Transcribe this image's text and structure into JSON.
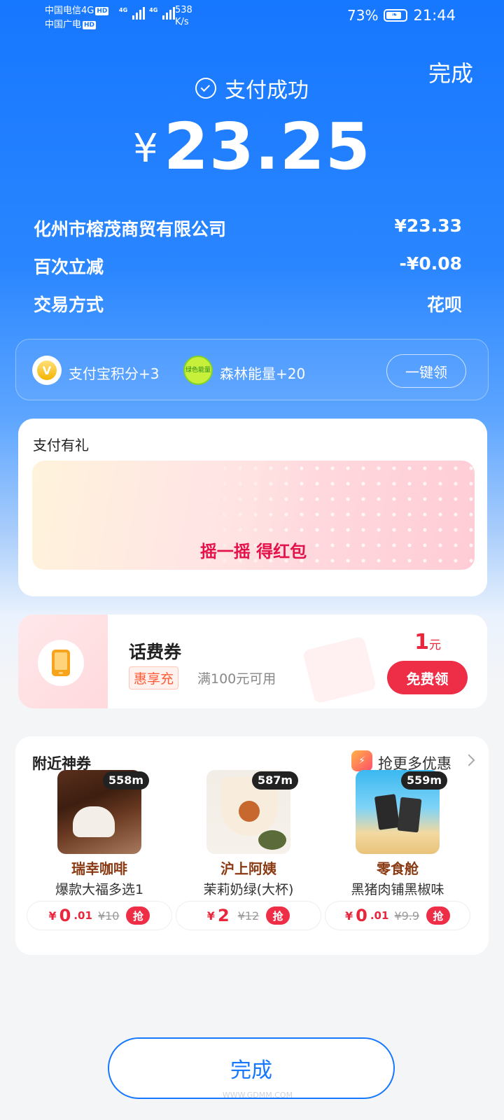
{
  "status_bar": {
    "carrier1": "中国电信4G",
    "carrier2": "中国广电",
    "hd": "HD",
    "net_small": "4G",
    "speed_value": "538",
    "speed_unit": "K/s",
    "battery": "73%",
    "time": "21:44"
  },
  "header": {
    "done_label": "完成",
    "success_label": "支付成功",
    "currency": "¥",
    "amount": "23.25"
  },
  "details": [
    {
      "label": "化州市榕茂商贸有限公司",
      "value": "¥23.33"
    },
    {
      "label": "百次立减",
      "value": "-¥0.08"
    },
    {
      "label": "交易方式",
      "value": "花呗"
    }
  ],
  "rewards": {
    "points": "支付宝积分+3",
    "points_icon_char": "V",
    "forest_icon_text": "绿色能量",
    "forest": "森林能量+20",
    "claim_label": "一键领"
  },
  "gift": {
    "title": "支付有礼",
    "banner_text": "摇一摇 得红包"
  },
  "voucher": {
    "title": "话费券",
    "tag": "惠享充",
    "condition": "满100元可用",
    "amount": "1",
    "unit": "元",
    "button": "免费领"
  },
  "nearby": {
    "title": "附近神券",
    "more_label": "抢更多优惠",
    "items": [
      {
        "distance": "558m",
        "shop": "瑞幸咖啡",
        "item": "爆款大福多选1",
        "price_int": "0",
        "price_dec": ".01",
        "orig": "¥10",
        "grab": "抢"
      },
      {
        "distance": "587m",
        "shop": "沪上阿姨",
        "item": "茉莉奶绿(大杯)",
        "price_int": "2",
        "price_dec": "",
        "orig": "¥12",
        "grab": "抢"
      },
      {
        "distance": "559m",
        "shop": "零食舱",
        "item": "黑猪肉铺黑椒味",
        "price_int": "0",
        "price_dec": ".01",
        "orig": "¥9.9",
        "grab": "抢"
      }
    ],
    "price_symbol": "¥"
  },
  "footer": {
    "done_label": "完成",
    "watermark": "WWW.GDMM.COM"
  }
}
